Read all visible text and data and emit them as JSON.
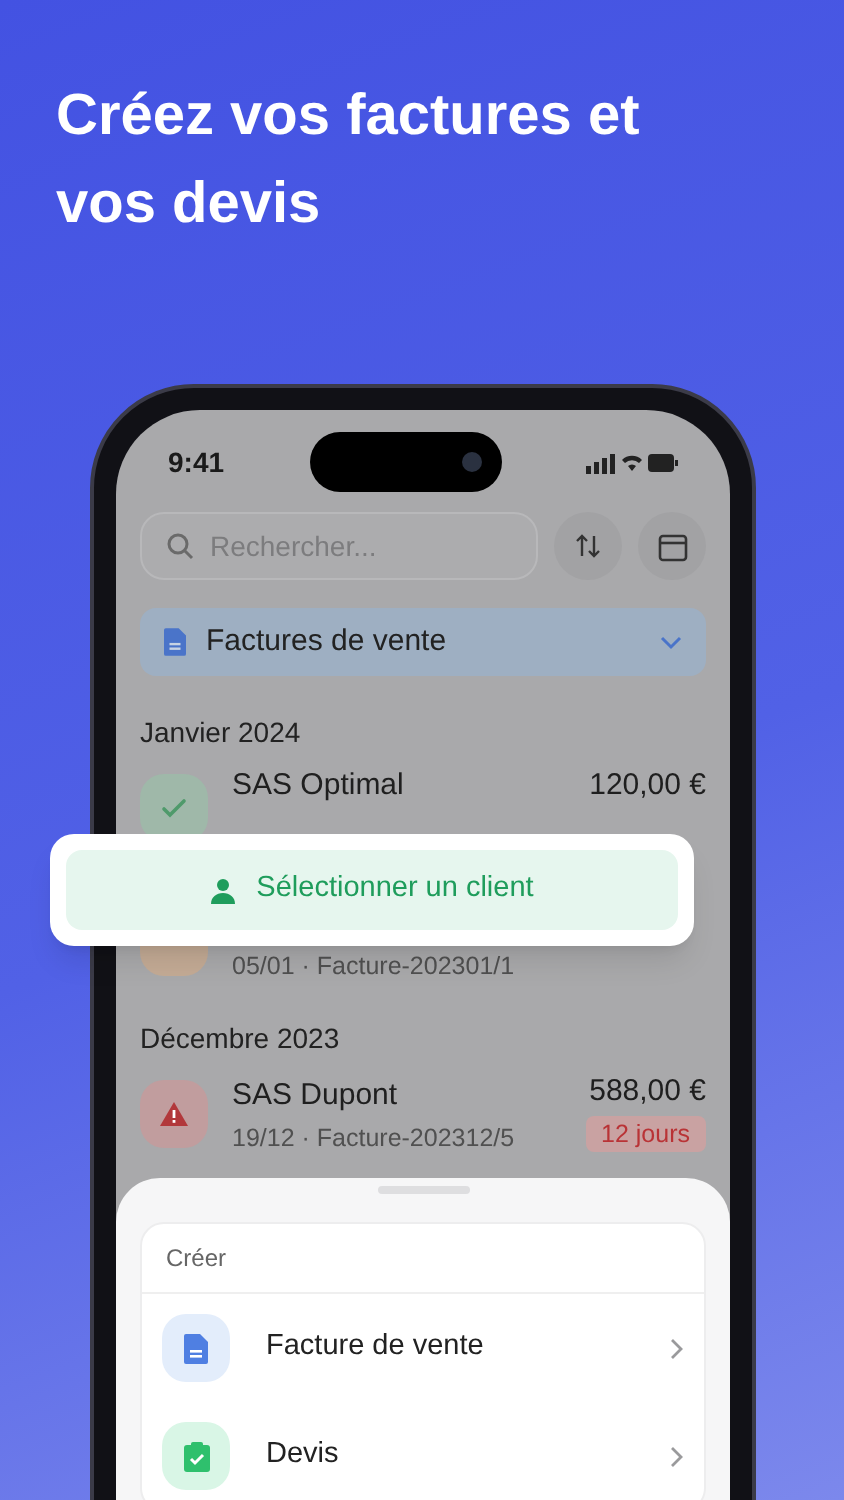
{
  "headline": "Créez vos factures et vos devis",
  "status_bar": {
    "time": "9:41"
  },
  "search": {
    "placeholder": "Rechercher..."
  },
  "filter": {
    "label": "Factures de vente"
  },
  "sections": [
    {
      "title": "Janvier 2024",
      "invoices": [
        {
          "client": "SAS Optimal",
          "amount": "120,00 €",
          "kind": "paid"
        },
        {
          "details": "05/01 · Facture-202301/1",
          "kind": "pending"
        }
      ]
    },
    {
      "title": "Décembre 2023",
      "invoices": [
        {
          "client": "SAS Dupont",
          "details": "19/12 · Facture-202312/5",
          "amount": "588,00 €",
          "kind": "overdue",
          "badge": "12 jours"
        }
      ]
    }
  ],
  "popup_button": {
    "label": "Sélectionner un client"
  },
  "create_sheet": {
    "title": "Créer",
    "items": [
      {
        "label": "Facture de vente",
        "kind": "invoice"
      },
      {
        "label": "Devis",
        "kind": "quote"
      }
    ]
  }
}
